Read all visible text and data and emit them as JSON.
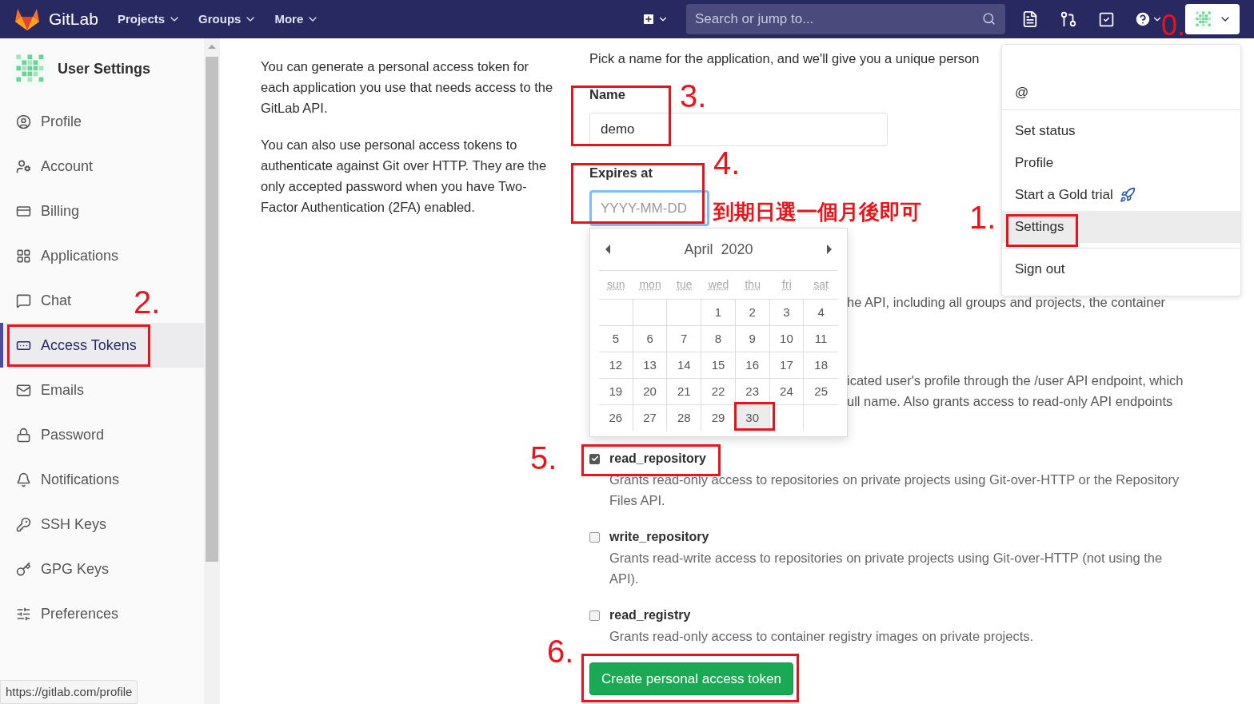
{
  "header": {
    "brand": "GitLab",
    "nav": [
      "Projects",
      "Groups",
      "More"
    ],
    "search": {
      "placeholder": "Search or jump to..."
    }
  },
  "sidebar": {
    "title": "User Settings",
    "items": [
      {
        "label": "Profile",
        "selected": false
      },
      {
        "label": "Account",
        "selected": false
      },
      {
        "label": "Billing",
        "selected": false
      },
      {
        "label": "Applications",
        "selected": false
      },
      {
        "label": "Chat",
        "selected": false
      },
      {
        "label": "Access Tokens",
        "selected": true
      },
      {
        "label": "Emails",
        "selected": false
      },
      {
        "label": "Password",
        "selected": false
      },
      {
        "label": "Notifications",
        "selected": false
      },
      {
        "label": "SSH Keys",
        "selected": false
      },
      {
        "label": "GPG Keys",
        "selected": false
      },
      {
        "label": "Preferences",
        "selected": false
      }
    ]
  },
  "intro": [
    "You can generate a personal access token for each application you use that needs access to the GitLab API.",
    "You can also use personal access tokens to authenticate against Git over HTTP. They are the only accepted password when you have Two-Factor Authentication (2FA) enabled."
  ],
  "form": {
    "description": "Pick a name for the application, and we'll give you a unique person",
    "name": {
      "label": "Name",
      "value": "demo"
    },
    "expires": {
      "label": "Expires at",
      "placeholder": "YYYY-MM-DD",
      "focused": true
    },
    "scope_fragments": [
      [
        "he API, including all groups and projects, the container"
      ],
      [
        "icated user's profile through the /user API endpoint, which",
        "ull name. Also grants access to read-only API endpoints"
      ]
    ],
    "scopes": [
      {
        "name": "read_repository",
        "checked": true,
        "description": "Grants read-only access to repositories on private projects using Git-over-HTTP or the Repository Files API."
      },
      {
        "name": "write_repository",
        "checked": false,
        "description": "Grants read-write access to repositories on private projects using Git-over-HTTP (not using the API)."
      },
      {
        "name": "read_registry",
        "checked": false,
        "description": "Grants read-only access to container registry images on private projects."
      }
    ],
    "submit": "Create personal access token"
  },
  "calendar": {
    "month": "April",
    "year": "2020",
    "weekdays": [
      "sun",
      "mon",
      "tue",
      "wed",
      "thu",
      "fri",
      "sat"
    ],
    "weeks": [
      [
        {
          "day": "1",
          "selected": false
        },
        {
          "day": "2",
          "selected": false
        },
        {
          "day": "3",
          "selected": false
        },
        {
          "day": "4",
          "selected": false
        }
      ],
      [
        {
          "day": "5",
          "selected": false
        },
        {
          "day": "6",
          "selected": false
        },
        {
          "day": "7",
          "selected": false
        },
        {
          "day": "8",
          "selected": false
        },
        {
          "day": "9",
          "selected": false
        },
        {
          "day": "10",
          "selected": false
        },
        {
          "day": "11",
          "selected": false
        }
      ],
      [
        {
          "day": "12",
          "selected": false
        },
        {
          "day": "13",
          "selected": false
        },
        {
          "day": "14",
          "selected": false
        },
        {
          "day": "15",
          "selected": false
        },
        {
          "day": "16",
          "selected": false
        },
        {
          "day": "17",
          "selected": false
        },
        {
          "day": "18",
          "selected": false
        }
      ],
      [
        {
          "day": "19",
          "selected": false
        },
        {
          "day": "20",
          "selected": false
        },
        {
          "day": "21",
          "selected": false
        },
        {
          "day": "22",
          "selected": false
        },
        {
          "day": "23",
          "selected": false
        },
        {
          "day": "24",
          "selected": false
        },
        {
          "day": "25",
          "selected": false
        }
      ],
      [
        {
          "day": "26",
          "selected": false
        },
        {
          "day": "27",
          "selected": false
        },
        {
          "day": "28",
          "selected": false
        },
        {
          "day": "29",
          "selected": false
        },
        {
          "day": "30",
          "selected": true
        }
      ]
    ]
  },
  "user_menu": {
    "items": [
      {
        "kind": "text",
        "label": "@"
      },
      {
        "kind": "divider"
      },
      {
        "kind": "link",
        "label": "Set status",
        "selected": false
      },
      {
        "kind": "link",
        "label": "Profile",
        "selected": false
      },
      {
        "kind": "trial",
        "label": "Start a Gold trial",
        "selected": false
      },
      {
        "kind": "link",
        "label": "Settings",
        "selected": true
      },
      {
        "kind": "divider"
      },
      {
        "kind": "link",
        "label": "Sign out",
        "selected": false
      }
    ]
  },
  "status_url": "https://gitlab.com/profile",
  "annotations": {
    "steps": [
      "0.",
      "1.",
      "2.",
      "3.",
      "4.",
      "5.",
      "6."
    ],
    "note": "到期日選一個月後即可"
  }
}
